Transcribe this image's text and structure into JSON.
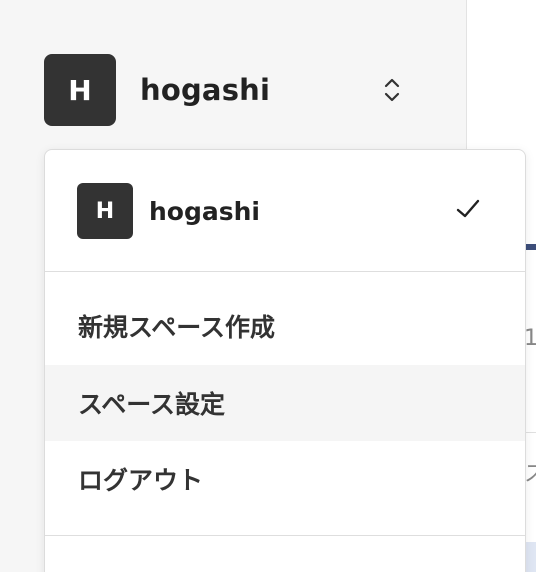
{
  "space": {
    "avatar_letter": "H",
    "name": "hogashi"
  },
  "dropdown": {
    "current_space": {
      "avatar_letter": "H",
      "name": "hogashi",
      "selected": true
    },
    "items": [
      {
        "label": "新規スペース作成"
      },
      {
        "label": "スペース設定",
        "highlighted": true
      },
      {
        "label": "ログアウト"
      }
    ]
  },
  "main": {
    "partial_text_1": "1",
    "partial_text_2": "ス"
  },
  "colors": {
    "avatar_bg": "#333333",
    "sidebar_bg": "#f6f6f6",
    "hover_bg": "#f5f5f5",
    "accent": "#3d4e7a"
  },
  "icons": {
    "switcher": "chevron-up-down-icon",
    "selected": "check-icon"
  }
}
